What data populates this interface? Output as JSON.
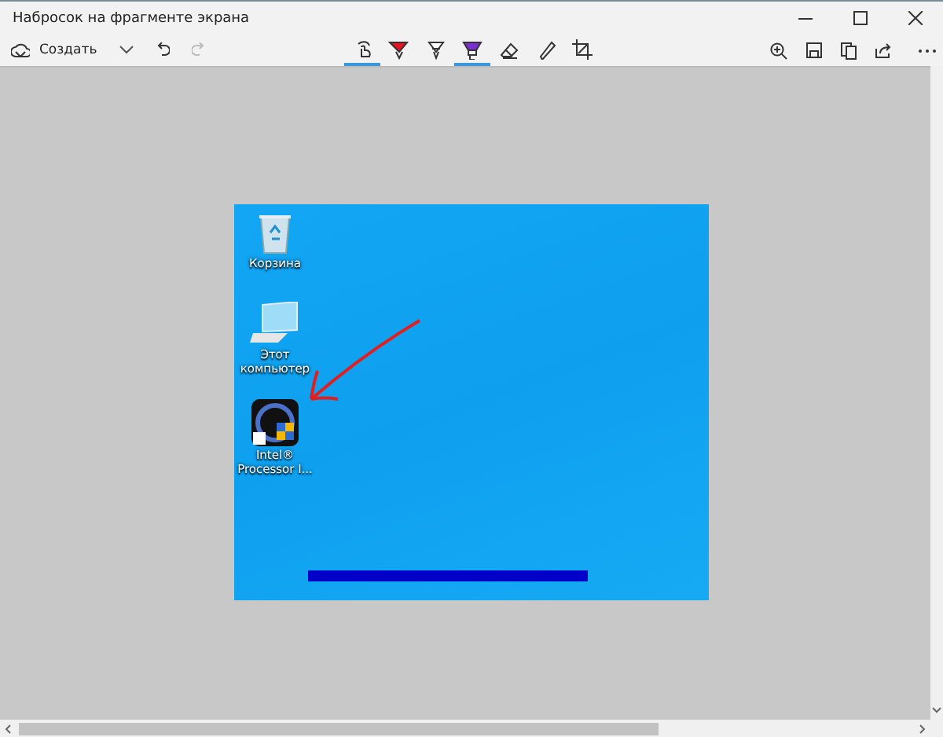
{
  "window": {
    "title": "Набросок на фрагменте экрана"
  },
  "toolbar": {
    "new_button": {
      "label": "Создать"
    },
    "tools": [
      {
        "kind": "touch",
        "selected": true
      },
      {
        "kind": "ballpoint",
        "selected": false,
        "color": "#e81123"
      },
      {
        "kind": "pencil",
        "selected": false,
        "color": "#ffffff"
      },
      {
        "kind": "highlighter",
        "selected": true,
        "color": "#7a2fd0"
      },
      {
        "kind": "eraser",
        "selected": false
      },
      {
        "kind": "ruler",
        "selected": false
      },
      {
        "kind": "crop",
        "selected": false
      }
    ]
  },
  "desktop_icons": [
    {
      "kind": "recycle-bin",
      "label": "Корзина"
    },
    {
      "kind": "computer",
      "label": "Этот компьютер"
    },
    {
      "kind": "app",
      "label": "Intel® Processor I..."
    }
  ]
}
